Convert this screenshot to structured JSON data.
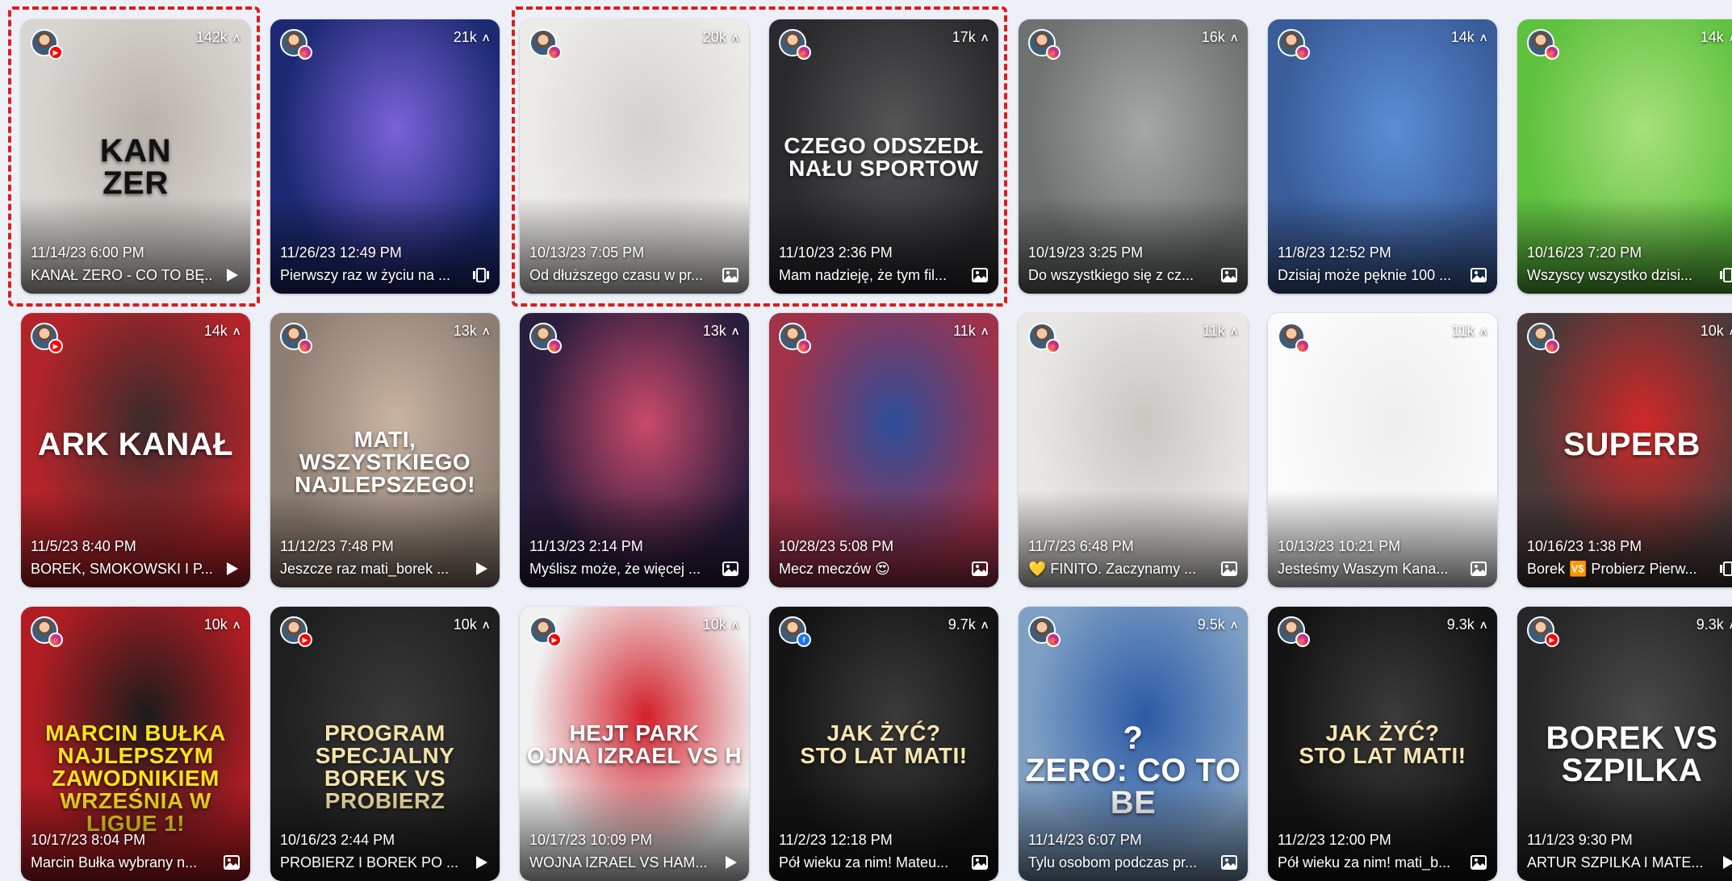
{
  "icons": {
    "like": "caret-up-icon",
    "video": "play-icon",
    "image": "image-icon",
    "carousel": "carousel-icon"
  },
  "platform_icons": {
    "youtube": "youtube-icon",
    "instagram": "instagram-icon",
    "facebook": "facebook-icon"
  },
  "colors": {
    "background": "#eef0f8",
    "selection": "#e01b1b",
    "youtube": "#ff0000",
    "facebook": "#1877f2"
  },
  "posts": [
    {
      "count": "142k",
      "date": "11/14/23 6:00 PM",
      "caption": "KANAŁ ZERO - CO TO BĘ...",
      "platform": "youtube",
      "type": "video",
      "thumb_text": "KAN\nZER",
      "text_color": "#111111",
      "bg": "#d9d6d2",
      "accent": "#b8b2ab"
    },
    {
      "count": "21k",
      "date": "11/26/23 12:49 PM",
      "caption": "Pierwszy raz w życiu na ...",
      "platform": "instagram",
      "type": "carousel",
      "thumb_text": "",
      "text_color": "#ffffff",
      "bg": "#1d2a73",
      "accent": "#7a62d8"
    },
    {
      "count": "20k",
      "date": "10/13/23 7:05 PM",
      "caption": "Od dłuższego czasu w pr...",
      "platform": "instagram",
      "type": "image",
      "thumb_text": "",
      "text_color": "#222222",
      "bg": "#ecebe8",
      "accent": "#d4d2cd"
    },
    {
      "count": "17k",
      "date": "11/10/23 2:36 PM",
      "caption": "Mam nadzieję, że tym fil...",
      "platform": "instagram",
      "type": "image",
      "thumb_text": "CZEGO ODSZEDŁ\nNAŁU SPORTOW",
      "text_color": "#ffffff",
      "bg": "#2a2a2e",
      "accent": "#555"
    },
    {
      "count": "16k",
      "date": "10/19/23 3:25 PM",
      "caption": "Do wszystkiego się z cz...",
      "platform": "instagram",
      "type": "image",
      "thumb_text": "",
      "text_color": "#ffffff",
      "bg": "#6e7270",
      "accent": "#a4a8a6"
    },
    {
      "count": "14k",
      "date": "11/8/23 12:52 PM",
      "caption": "Dzisiaj może pęknie 100 ...",
      "platform": "instagram",
      "type": "image",
      "thumb_text": "",
      "text_color": "#ffffff",
      "bg": "#3a5d9a",
      "accent": "#5b8ed6"
    },
    {
      "count": "14k",
      "date": "10/16/23 7:20 PM",
      "caption": "Wszyscy wszystko dzisi...",
      "platform": "instagram",
      "type": "carousel",
      "thumb_text": "",
      "text_color": "#ffffff",
      "bg": "#5fc23f",
      "accent": "#a9e07c"
    },
    {
      "count": "14k",
      "date": "11/5/23 8:40 PM",
      "caption": "BOREK, SMOKOWSKI I P...",
      "platform": "youtube",
      "type": "video",
      "thumb_text": "ARK          KANAŁ",
      "text_color": "#ffffff",
      "bg": "#b3242a",
      "accent": "#3a2b2b"
    },
    {
      "count": "13k",
      "date": "11/12/23 7:48 PM",
      "caption": "Jeszcze raz mati_borek ...",
      "platform": "instagram",
      "type": "video",
      "thumb_text": "MATI,\nWSZYSTKIEGO NAJLEPSZEGO!",
      "text_color": "#ffffff",
      "bg": "#8f7f73",
      "accent": "#c7b4a4"
    },
    {
      "count": "13k",
      "date": "11/13/23 2:14 PM",
      "caption": "Myślisz może, że więcej ...",
      "platform": "instagram",
      "type": "image",
      "thumb_text": "",
      "text_color": "#ffffff",
      "bg": "#2a1d3d",
      "accent": "#c94a6a"
    },
    {
      "count": "11k",
      "date": "10/28/23 5:08 PM",
      "caption": "Mecz meczów 😍",
      "platform": "instagram",
      "type": "image",
      "thumb_text": "",
      "text_color": "#ffffff",
      "bg": "#a0324a",
      "accent": "#2d4f9a"
    },
    {
      "count": "11k",
      "date": "11/7/23 6:48 PM",
      "caption": "💛 FINITO. Zaczynamy ...",
      "platform": "instagram",
      "type": "image",
      "thumb_text": "",
      "text_color": "#333333",
      "bg": "#e9e8e5",
      "accent": "#c9c7c2"
    },
    {
      "count": "11k",
      "date": "10/13/23 10:21 PM",
      "caption": "Jesteśmy Waszym Kana...",
      "platform": "instagram",
      "type": "image",
      "thumb_text": "",
      "text_color": "#222222",
      "bg": "#fbfbfb",
      "accent": "#eeeeee"
    },
    {
      "count": "10k",
      "date": "10/16/23 1:38 PM",
      "caption": "Borek 🆚 Probierz Pierw...",
      "platform": "instagram",
      "type": "carousel",
      "thumb_text": "SUPERB",
      "text_color": "#ffffff",
      "bg": "#4a3a3a",
      "accent": "#d02828"
    },
    {
      "count": "10k",
      "date": "10/17/23 8:04 PM",
      "caption": "Marcin Bułka wybrany n...",
      "platform": "instagram",
      "type": "image",
      "thumb_text": "MARCIN BUŁKA\nNAJLEPSZYM ZAWODNIKIEM\nWRZEŚNIA W LIGUE 1!",
      "text_color": "#ffe21a",
      "bg": "#b11d23",
      "accent": "#1b1b1b"
    },
    {
      "count": "10k",
      "date": "10/16/23 2:44 PM",
      "caption": "PROBIERZ I BOREK PO ...",
      "platform": "youtube",
      "type": "video",
      "thumb_text": "PROGRAM\nSPECJALNY\nBOREK VS\nPROBIERZ",
      "text_color": "#f3e3a6",
      "bg": "#1f1f1f",
      "accent": "#3a3a3a"
    },
    {
      "count": "10k",
      "date": "10/17/23 10:09 PM",
      "caption": "WOJNA IZRAEL VS HAM...",
      "platform": "youtube",
      "type": "video",
      "thumb_text": "HEJT PARK\nOJNA IZRAEL VS H",
      "text_color": "#ffffff",
      "bg": "#f1f1f1",
      "accent": "#d3202a"
    },
    {
      "count": "9.7k",
      "date": "11/2/23 12:18 PM",
      "caption": "Pół wieku za nim! Mateu...",
      "platform": "facebook",
      "type": "image",
      "thumb_text": "Jak żyć?\nSto lat Mati!",
      "text_color": "#f5e6b0",
      "bg": "#141414",
      "accent": "#3b3b3b"
    },
    {
      "count": "9.5k",
      "date": "11/14/23 6:07 PM",
      "caption": "Tylu osobom podczas pr...",
      "platform": "instagram",
      "type": "image",
      "thumb_text": "?\nZERO: CO TO BE",
      "text_color": "#ffffff",
      "bg": "#7fa0c4",
      "accent": "#2c5aa5"
    },
    {
      "count": "9.3k",
      "date": "11/2/23 12:00 PM",
      "caption": "Pół wieku za nim! mati_b...",
      "platform": "instagram",
      "type": "image",
      "thumb_text": "Jak żyć?\nSto lat Mati!",
      "text_color": "#f5e6b0",
      "bg": "#141414",
      "accent": "#3b3b3b"
    },
    {
      "count": "9.3k",
      "date": "11/1/23 9:30 PM",
      "caption": "ARTUR SZPILKA I MATE...",
      "platform": "youtube",
      "type": "video",
      "thumb_text": "BOREK VS\nSZPILKA",
      "text_color": "#ffffff",
      "bg": "#262626",
      "accent": "#4a4a4a"
    }
  ]
}
